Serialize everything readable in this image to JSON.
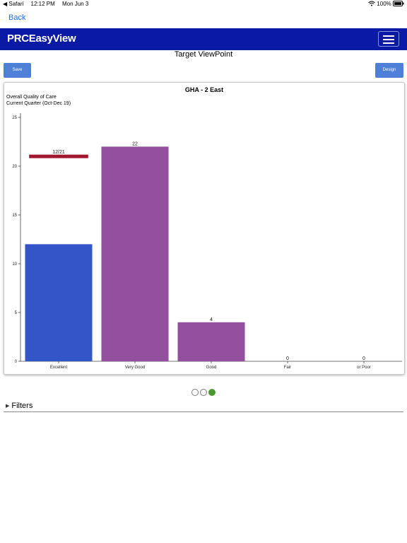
{
  "status": {
    "carrier": "◀ Safari",
    "time": "12:12 PM",
    "date": "Mon Jun 3",
    "battery": "100%"
  },
  "nav": {
    "back_label": "Back"
  },
  "app": {
    "logo_bold": "PRC",
    "logo_rest": "EasyView"
  },
  "page": {
    "title": "Target ViewPoint"
  },
  "toolbar": {
    "save_label": "Save",
    "design_label": "Design"
  },
  "chart": {
    "subtitle_line1": "Overall Quality of Care",
    "subtitle_line2": "Current Quarter (Oct-Dec 19)"
  },
  "chart_data": {
    "type": "bar",
    "title": "GHA - 2 East",
    "categories": [
      "Excellent",
      "Very Good",
      "Good",
      "Fair",
      "or Poor"
    ],
    "values": [
      12,
      22,
      4,
      0,
      0
    ],
    "labels": [
      "12/21",
      "22",
      "4",
      "0",
      "0"
    ],
    "colors": [
      "#3355c8",
      "#92509e",
      "#92509e",
      "#92509e",
      "#92509e"
    ],
    "target": {
      "category": "Excellent",
      "value": 21,
      "color": "#a01830"
    },
    "ylim": [
      0,
      25
    ],
    "yticks": [
      0,
      5,
      10,
      15,
      20,
      25
    ],
    "xlabel": "",
    "ylabel": ""
  },
  "pager": {
    "pages": 3,
    "active": 2
  },
  "filters": {
    "label": "Filters"
  }
}
